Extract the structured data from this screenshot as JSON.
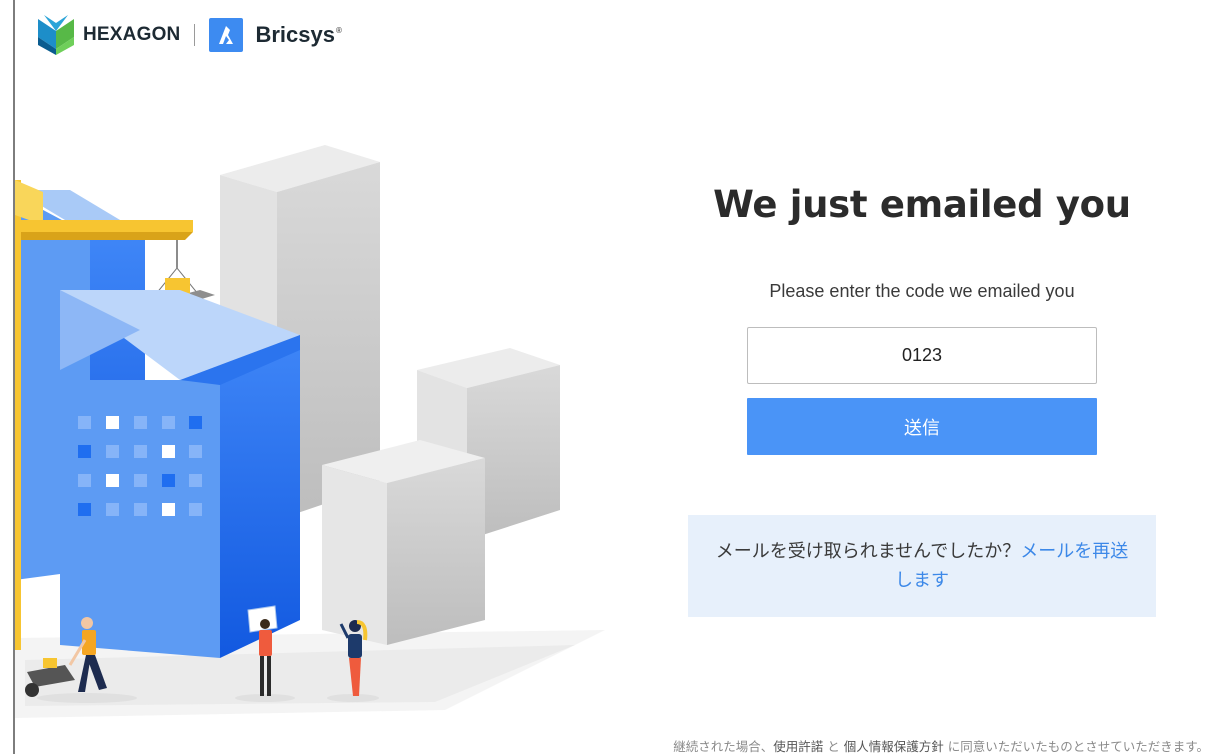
{
  "brand": {
    "hexagon": "HEXAGON",
    "bricsys": "Bricsys",
    "bricsys_mark": "®"
  },
  "form": {
    "title": "We just emailed you",
    "subtitle": "Please enter the code we emailed you",
    "code_value": "0123",
    "submit_label": "送信"
  },
  "resend": {
    "prompt": "メールを受け取られませんでしたか？",
    "link": "メールを再送します"
  },
  "footer": {
    "text1": "継続された場合、",
    "terms": "使用許諾",
    "and": " と ",
    "privacy": "個人情報保護方針",
    "text2": " に同意いただいたものとさせていただきます。"
  },
  "colors": {
    "accent": "#4a94f7",
    "link": "#3c88e8",
    "resend_bg": "#e7f0fb",
    "building_blue": "#1f6ef0",
    "crane_yellow": "#f7c531"
  },
  "icons": {
    "hexagon_logo": "hexagon-logo-icon",
    "bricsys_logo": "bricsys-logo-icon"
  }
}
